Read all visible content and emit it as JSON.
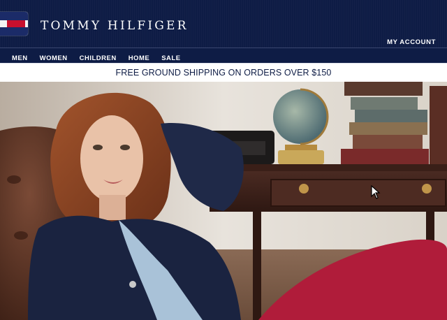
{
  "header": {
    "brand": "TOMMY HILFIGER",
    "account_link": "MY ACCOUNT"
  },
  "nav": {
    "items": [
      "MEN",
      "WOMEN",
      "CHILDREN",
      "HOME",
      "SALE"
    ]
  },
  "promo": {
    "text": "FREE GROUND SHIPPING ON ORDERS OVER $150"
  },
  "colors": {
    "header_bg": "#0e1c45",
    "promo_text": "#0e1c45",
    "flag_red": "#c8102e",
    "flag_navy": "#1b2b68"
  }
}
